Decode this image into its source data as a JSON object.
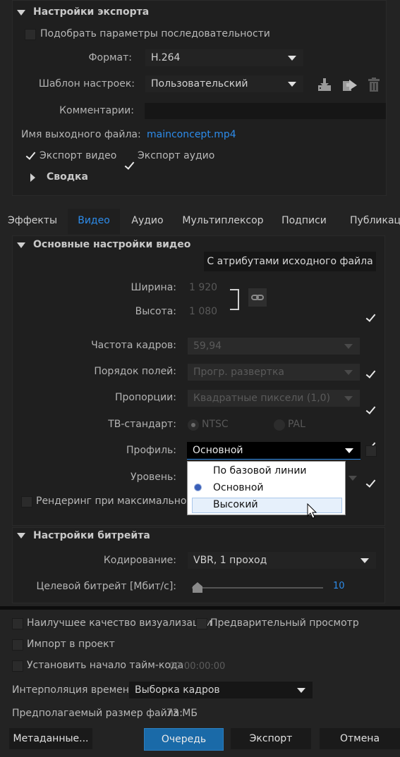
{
  "export_settings": {
    "title": "Настройки экспорта",
    "match_sequence_label": "Подобрать параметры последовательности",
    "format_label": "Формат:",
    "format_value": "H.264",
    "preset_label": "Шаблон настроек:",
    "preset_value": "Пользовательский",
    "comments_label": "Комментарии:",
    "comments_value": "",
    "output_name_label": "Имя выходного файла:",
    "output_name_value": "mainconcept.mp4",
    "export_video_label": "Экспорт видео",
    "export_audio_label": "Экспорт аудио",
    "summary_label": "Сводка"
  },
  "tabs": [
    "Эффекты",
    "Видео",
    "Аудио",
    "Мультиплексор",
    "Подписи",
    "Публикаци"
  ],
  "video": {
    "basic_title": "Основные настройки видео",
    "match_source_button": "С атрибутами исходного файла",
    "width_label": "Ширина:",
    "width_value": "1 920",
    "height_label": "Высота:",
    "height_value": "1 080",
    "frame_rate_label": "Частота кадров:",
    "frame_rate_value": "59,94",
    "field_order_label": "Порядок полей:",
    "field_order_value": "Прогр. развертка",
    "aspect_label": "Пропорции:",
    "aspect_value": "Квадратные пиксели (1,0)",
    "tv_standard_label": "ТВ-стандарт:",
    "ntsc_label": "NTSC",
    "pal_label": "PAL",
    "profile_label": "Профиль:",
    "profile_value": "Основной",
    "level_label": "Уровень:",
    "render_max_label": "Рендеринг при максимальной глу",
    "profile_options": [
      "По базовой линии",
      "Основной",
      "Высокий"
    ],
    "profile_selected": "Основной",
    "profile_hovered": "Высокий"
  },
  "bitrate": {
    "title": "Настройки битрейта",
    "encoding_label": "Кодирование:",
    "encoding_value": "VBR, 1 проход",
    "target_label": "Целевой битрейт [Мбит/с]:",
    "target_value": "10",
    "slider_fraction": 0.0
  },
  "bottom": {
    "max_quality_label": "Наилучшее качество визуализации",
    "preview_label": "Предварительный просмотр",
    "import_label": "Импорт в проект",
    "timecode_label": "Установить начало тайм-кода",
    "timecode_value": "00:00:00:00",
    "interp_label": "Интерполяция времени:",
    "interp_value": "Выборка кадров",
    "filesize_label": "Предполагаемый размер файла:",
    "filesize_value": "73 МБ",
    "metadata_button": "Метаданные...",
    "queue_button": "Очередь",
    "export_button": "Экспорт",
    "cancel_button": "Отмена"
  },
  "colors": {
    "accent": "#2d8ceb",
    "queue_button": "#1a6aa8",
    "background": "#232323"
  }
}
